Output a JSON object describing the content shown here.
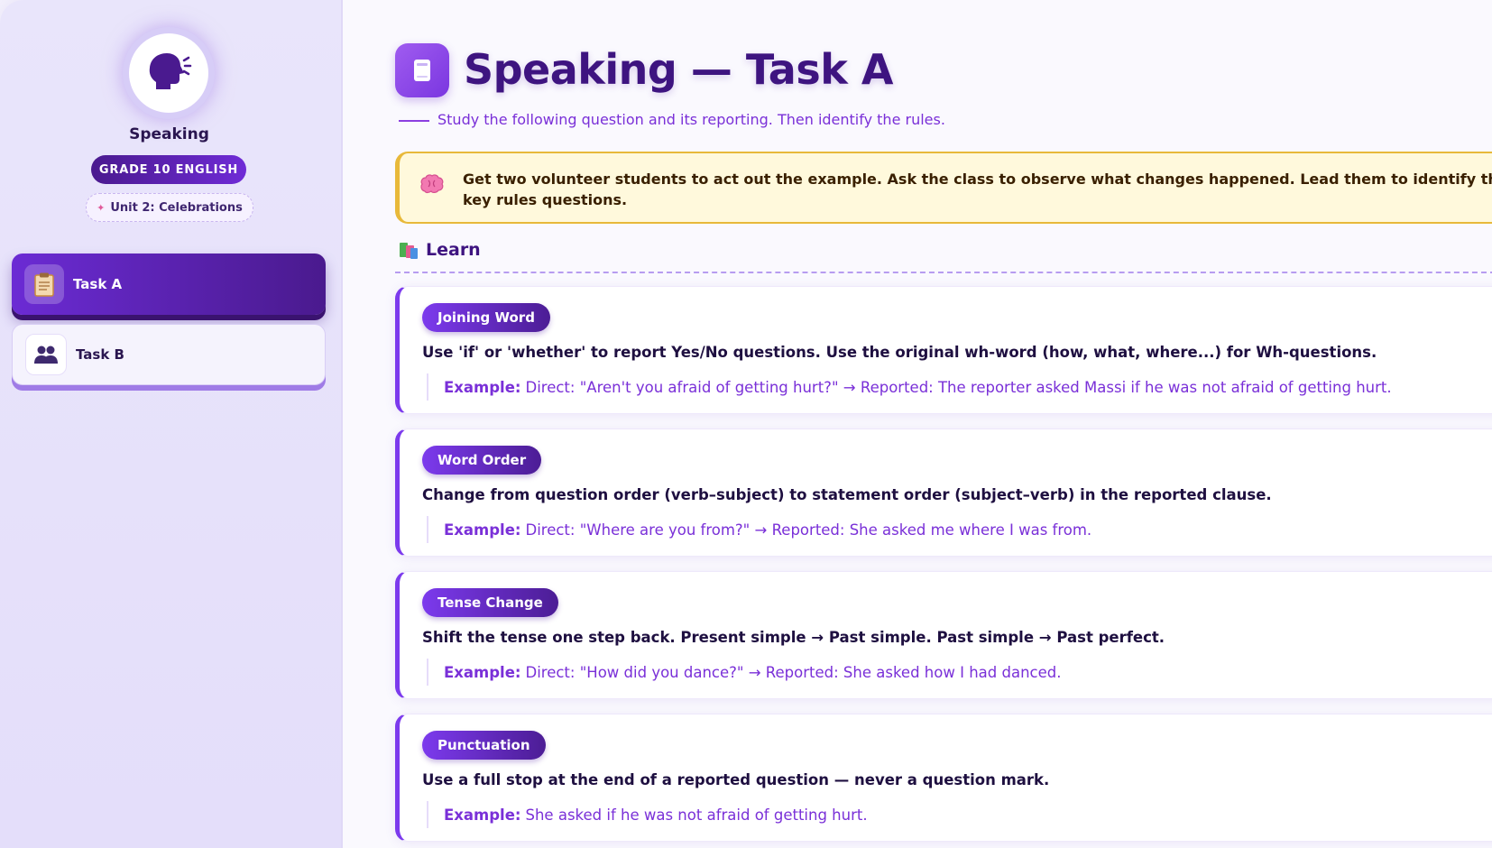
{
  "sidebar": {
    "title": "Speaking",
    "grade": "GRADE 10 ENGLISH",
    "unit": "Unit 2: Celebrations",
    "tasks": [
      {
        "label": "Task A",
        "icon": "clipboard-icon",
        "active": true
      },
      {
        "label": "Task B",
        "icon": "people-icon",
        "active": false
      }
    ]
  },
  "main": {
    "title": "Speaking — Task A",
    "subtitle": "Study the following question and its reporting. Then identify the rules.",
    "note": "Get two volunteer students to act out the example. Ask the class to observe what changes happened. Lead them to identify the key rules questions.",
    "learn_heading": "Learn",
    "example_label": "Example:",
    "rules": [
      {
        "badge": "Joining Word",
        "text": "Use 'if' or 'whether' to report Yes/No questions. Use the original wh-word (how, what, where...) for Wh-questions.",
        "example": "Direct: \"Aren't you afraid of getting hurt?\" → Reported: The reporter asked Massi if he was not afraid of getting hurt."
      },
      {
        "badge": "Word Order",
        "text": "Change from question order (verb–subject) to statement order (subject–verb) in the reported clause.",
        "example": "Direct: \"Where are you from?\" → Reported: She asked me where I was from."
      },
      {
        "badge": "Tense Change",
        "text": "Shift the tense one step back. Present simple → Past simple. Past simple → Past perfect.",
        "example": "Direct: \"How did you dance?\" → Reported: She asked how I had danced."
      },
      {
        "badge": "Punctuation",
        "text": "Use a full stop at the end of a reported question — never a question mark.",
        "example": "She asked if he was not afraid of getting hurt."
      }
    ]
  },
  "colors": {
    "accent": "#7c3aed",
    "dark": "#4c1d95",
    "note_bg": "#fff9dc",
    "note_border": "#e8b93a"
  }
}
